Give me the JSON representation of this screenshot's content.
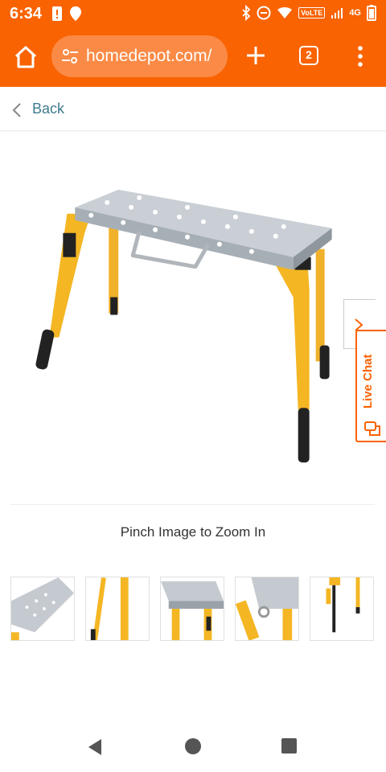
{
  "status_bar": {
    "time": "6:34",
    "volte_label": "VoLTE",
    "network_label": "4G"
  },
  "browser": {
    "url": "homedepot.com/",
    "tab_count": "2"
  },
  "page": {
    "back_label": "Back",
    "zoom_hint": "Pinch Image to Zoom In",
    "live_chat_label": "Live Chat",
    "thumbnail_count": 5
  },
  "colors": {
    "brand_orange": "#f96302",
    "link_teal": "#3e7b8f"
  }
}
